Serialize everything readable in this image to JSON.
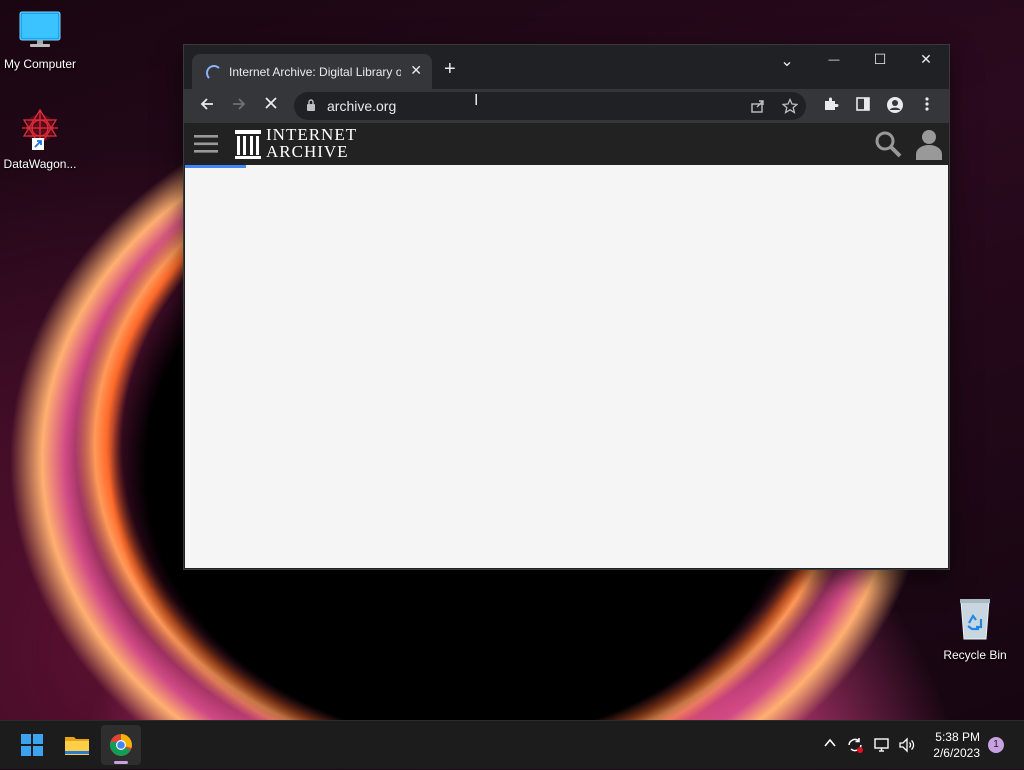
{
  "desktop": {
    "icons": [
      {
        "label": "My Computer"
      },
      {
        "label": "DataWagon..."
      },
      {
        "label": "Recycle Bin"
      }
    ]
  },
  "browser": {
    "tab": {
      "title": "Internet Archive: Digital Library of Free & Borrowable Books"
    },
    "address": {
      "url": "archive.org"
    },
    "window_controls": {
      "list_tabs": "⌄",
      "minimize": "—",
      "maximize": "☐",
      "close": "✕"
    }
  },
  "site": {
    "logo_line1": "INTERNET",
    "logo_line2": "ARCHIVE",
    "load_progress": 0.08
  },
  "taskbar": {
    "time": "5:38 PM",
    "date": "2/6/2023",
    "notification_count": "1"
  },
  "colors": {
    "chrome_dark": "#202124",
    "chrome_toolbar": "#35363a",
    "ia_header": "#222222",
    "load_blue": "#4285f4",
    "page_bg": "#f5f5f6"
  }
}
